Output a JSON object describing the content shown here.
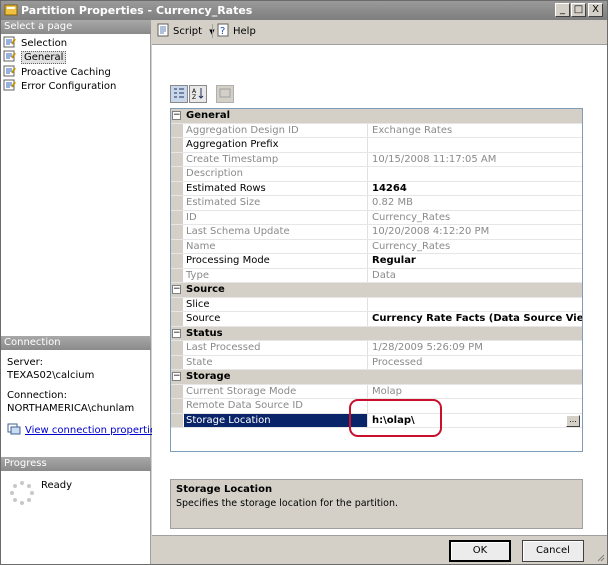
{
  "window": {
    "title": "Partition Properties - Currency_Rates",
    "controls": [
      "_",
      "□",
      "X"
    ]
  },
  "left_panel": {
    "select_page_header": "Select a page",
    "pages": [
      {
        "label": "Selection",
        "icon": "page-icon"
      },
      {
        "label": "General",
        "icon": "page-icon",
        "selected": true
      },
      {
        "label": "Proactive Caching",
        "icon": "page-icon"
      },
      {
        "label": "Error Configuration",
        "icon": "page-icon"
      }
    ],
    "connection": {
      "header": "Connection",
      "server_label": "Server:",
      "server_value": "TEXAS02\\calcium",
      "connection_label": "Connection:",
      "connection_value": "NORTHAMERICA\\chunlam",
      "link": "View connection properties"
    },
    "progress": {
      "header": "Progress",
      "status": "Ready"
    }
  },
  "toolbar": {
    "script": "Script",
    "help": "Help"
  },
  "property_grid": {
    "rows": [
      {
        "type": "category",
        "name": "General"
      },
      {
        "type": "prop",
        "name": "Aggregation Design ID",
        "value": "Exchange Rates",
        "dim": true
      },
      {
        "type": "prop",
        "name": "Aggregation Prefix",
        "value": ""
      },
      {
        "type": "prop",
        "name": "Create Timestamp",
        "value": "10/15/2008 11:17:05 AM",
        "dim": true
      },
      {
        "type": "prop",
        "name": "Description",
        "value": "",
        "dim": true
      },
      {
        "type": "prop",
        "name": "Estimated Rows",
        "value": "14264",
        "bold": true
      },
      {
        "type": "prop",
        "name": "Estimated Size",
        "value": "0.82 MB",
        "dim": true
      },
      {
        "type": "prop",
        "name": "ID",
        "value": "Currency_Rates",
        "dim": true
      },
      {
        "type": "prop",
        "name": "Last Schema Update",
        "value": "10/20/2008 4:12:20 PM",
        "dim": true
      },
      {
        "type": "prop",
        "name": "Name",
        "value": "Currency_Rates",
        "dim": true
      },
      {
        "type": "prop",
        "name": "Processing Mode",
        "value": "Regular",
        "bold": true
      },
      {
        "type": "prop",
        "name": "Type",
        "value": "Data",
        "dim": true
      },
      {
        "type": "category",
        "name": "Source"
      },
      {
        "type": "prop",
        "name": "Slice",
        "value": ""
      },
      {
        "type": "prop",
        "name": "Source",
        "value": "Currency Rate Facts (Data Source View Ta",
        "bold": true
      },
      {
        "type": "category",
        "name": "Status"
      },
      {
        "type": "prop",
        "name": "Last Processed",
        "value": "1/28/2009 5:26:09 PM",
        "dim": true
      },
      {
        "type": "prop",
        "name": "State",
        "value": "Processed",
        "dim": true
      },
      {
        "type": "category",
        "name": "Storage"
      },
      {
        "type": "prop",
        "name": "Current Storage Mode",
        "value": "Molap",
        "dim": true
      },
      {
        "type": "prop",
        "name": "Remote Data Source ID",
        "value": "",
        "dim": true
      },
      {
        "type": "prop",
        "name": "Storage Location",
        "value": "h:\\olap\\",
        "selected": true
      }
    ]
  },
  "description": {
    "title": "Storage Location",
    "text": "Specifies the storage location for the partition."
  },
  "buttons": {
    "ok": "OK",
    "cancel": "Cancel"
  },
  "colors": {
    "selection": "#0a246a",
    "highlight_circle": "#c8102e"
  }
}
